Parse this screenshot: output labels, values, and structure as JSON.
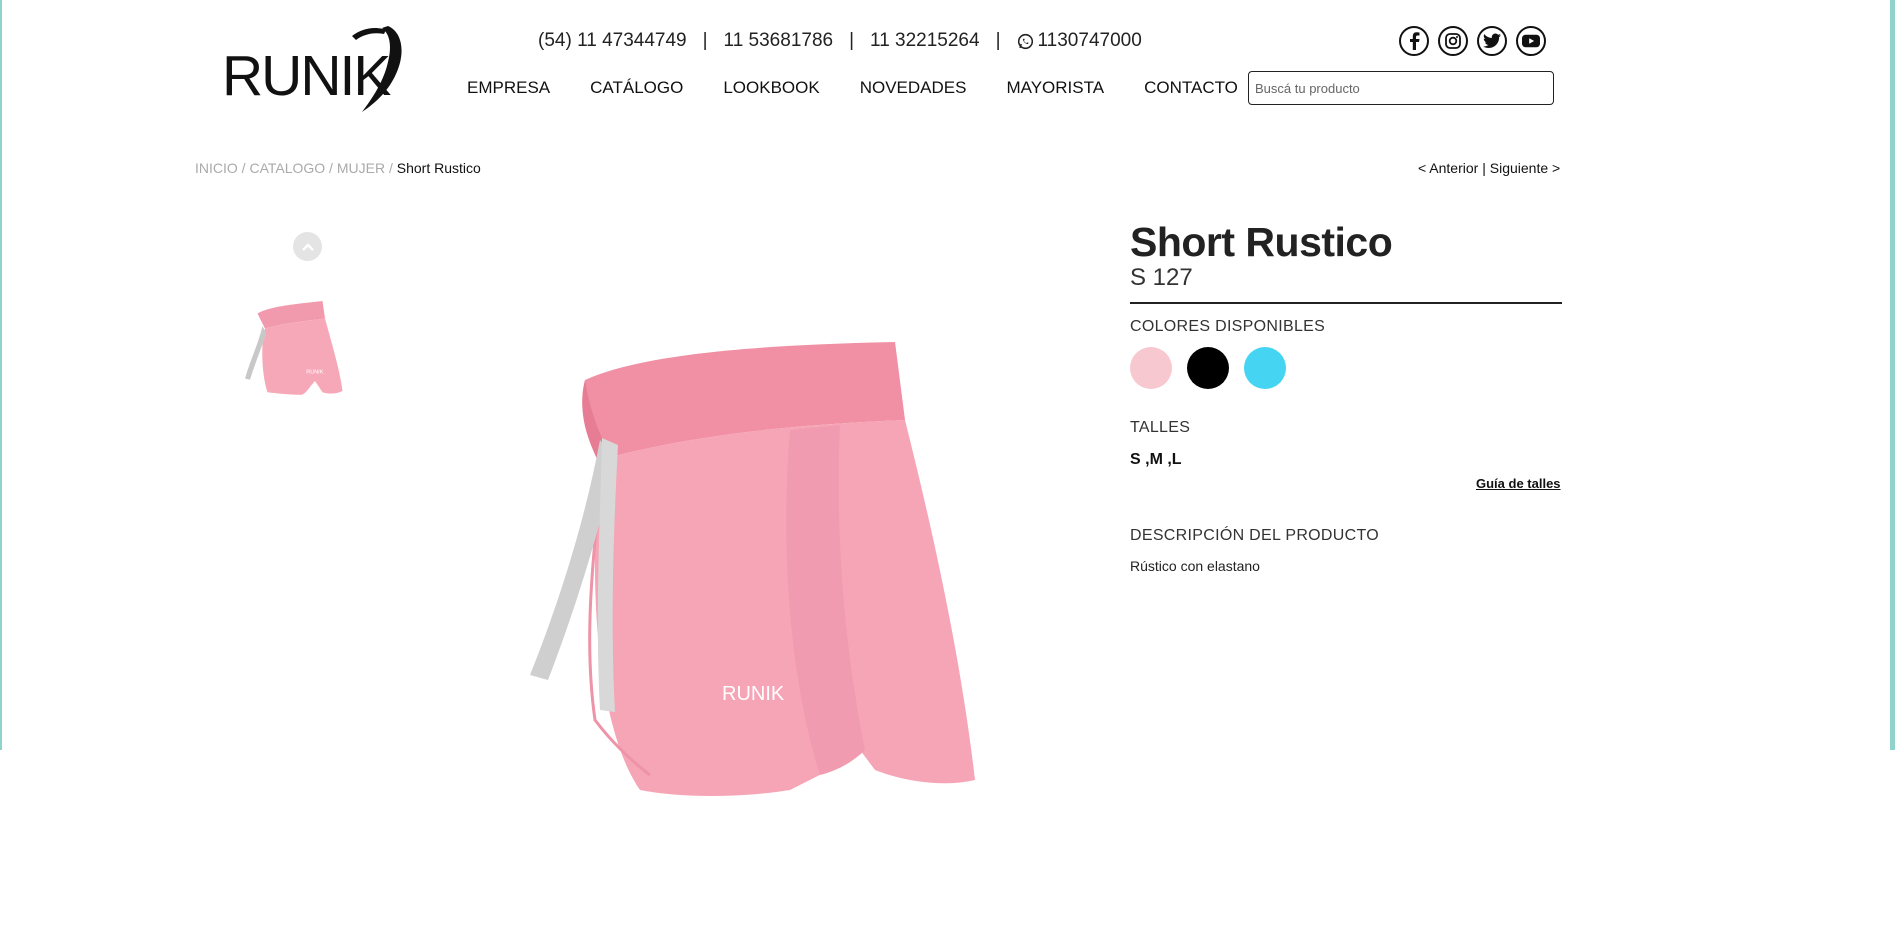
{
  "brand": {
    "logo_text": "RUNIK"
  },
  "header": {
    "phones": [
      "(54) 11 47344749",
      "11 53681786",
      "11 32215264"
    ],
    "separator": "|",
    "whatsapp": "1130747000",
    "whatsapp_icon": "whatsapp-icon",
    "nav": [
      "EMPRESA",
      "CATÁLOGO",
      "LOOKBOOK",
      "NOVEDADES",
      "MAYORISTA",
      "CONTACTO"
    ],
    "social": [
      "facebook-icon",
      "instagram-icon",
      "twitter-icon",
      "youtube-icon"
    ],
    "search": {
      "placeholder": "Buscá tu producto",
      "value": ""
    }
  },
  "breadcrumb": {
    "items": [
      "INICIO",
      "CATALOGO",
      "MUJER"
    ],
    "separator": " / ",
    "current": "Short Rustico"
  },
  "pager": {
    "prev": "< Anterior",
    "divider": "|",
    "next": "Siguiente >"
  },
  "gallery": {
    "up_icon": "chevron-up-icon",
    "thumbnail_logo": "RUNIK",
    "main_logo": "RUNIK"
  },
  "product": {
    "title": "Short Rustico",
    "sku": "S 127",
    "colors_label": "COLORES DISPONIBLES",
    "colors": [
      "#f7c8cf",
      "#000000",
      "#45d5f2"
    ],
    "sizes_label": "TALLES",
    "sizes": "S ,M ,L",
    "size_guide": "Guía de talles",
    "description_label": "DESCRIPCIÓN DEL PRODUCTO",
    "description": "Rústico con elastano"
  },
  "theme": {
    "accent": "#8fd3cc",
    "product_pink": "#f48fa6"
  }
}
